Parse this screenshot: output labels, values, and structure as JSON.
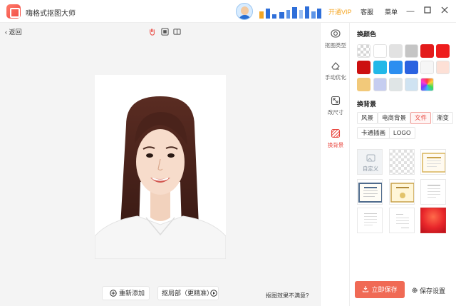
{
  "titlebar": {
    "app_title": "嗨格式抠图大师",
    "vip_label": "开通VIP",
    "service_label": "客服",
    "menu_label": "菜单",
    "accent": "#f5a623"
  },
  "canvas": {
    "back_label": "返回",
    "re_add_label": "重新添加",
    "local_cutout_label": "抠局部（更精准）",
    "feedback_label": "抠图效果不满意?"
  },
  "side_nav": {
    "items": [
      {
        "label": "抠图类型",
        "icon": "cutout-type-icon"
      },
      {
        "label": "手动优化",
        "icon": "eraser-icon"
      },
      {
        "label": "改尺寸",
        "icon": "resize-icon"
      },
      {
        "label": "换背景",
        "icon": "background-icon",
        "active": true
      }
    ],
    "active_color": "#e9473f"
  },
  "panel": {
    "color_title": "换颜色",
    "colors": [
      "transparent",
      "#ffffff",
      "#e2e2e2",
      "#c5c5c5",
      "#e31b1b",
      "#ee1d1d",
      "#cc1010",
      "#22b8e8",
      "#2b8ef0",
      "#2a62e0",
      "#f6f6f6",
      "#fde0d6",
      "#f2c97a",
      "#c6cdf0",
      "#dfe5e6",
      "#cfe3f2",
      "rainbow"
    ],
    "bg_title": "换背景",
    "bg_categories": [
      "风景",
      "电商背景",
      "文件",
      "渐变",
      "卡通插画",
      "LOGO"
    ],
    "active_category": "文件",
    "custom_label": "自定义",
    "save_label": "立即保存",
    "settings_label": "保存设置",
    "save_color": "#f06a55"
  }
}
